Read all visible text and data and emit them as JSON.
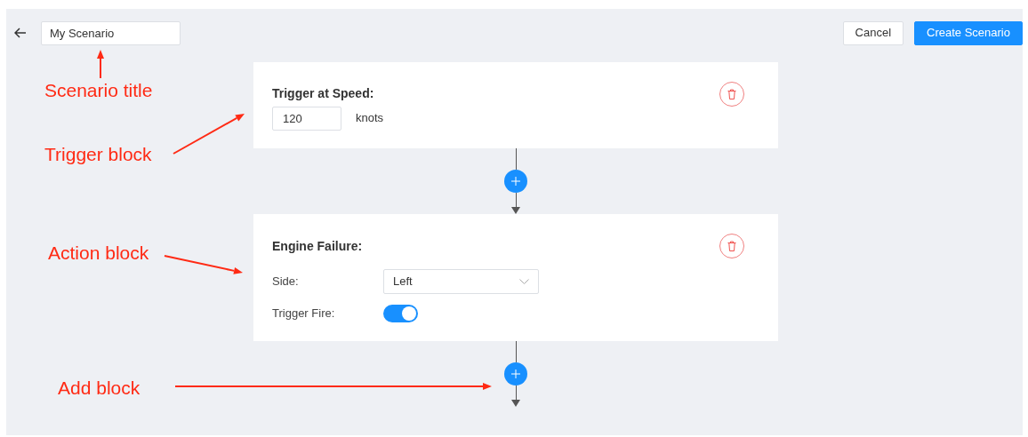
{
  "header": {
    "title_field": {
      "value": "My Scenario"
    },
    "buttons": [
      {
        "label": "Cancel",
        "kind": "secondary"
      },
      {
        "label": "Create Scenario",
        "kind": "primary"
      }
    ]
  },
  "blocks": [
    {
      "kind": "trigger",
      "title": "Trigger at Speed:",
      "value": "120",
      "unit": "knots"
    },
    {
      "kind": "action",
      "title": "Engine Failure:",
      "fields": [
        {
          "kind": "select",
          "label": "Side:",
          "value": "Left"
        },
        {
          "kind": "toggle",
          "label": "Trigger Fire:",
          "on": true
        }
      ]
    }
  ],
  "annotations": [
    {
      "text": "Scenario title"
    },
    {
      "text": "Trigger block"
    },
    {
      "text": "Action block"
    },
    {
      "text": "Add block"
    }
  ]
}
